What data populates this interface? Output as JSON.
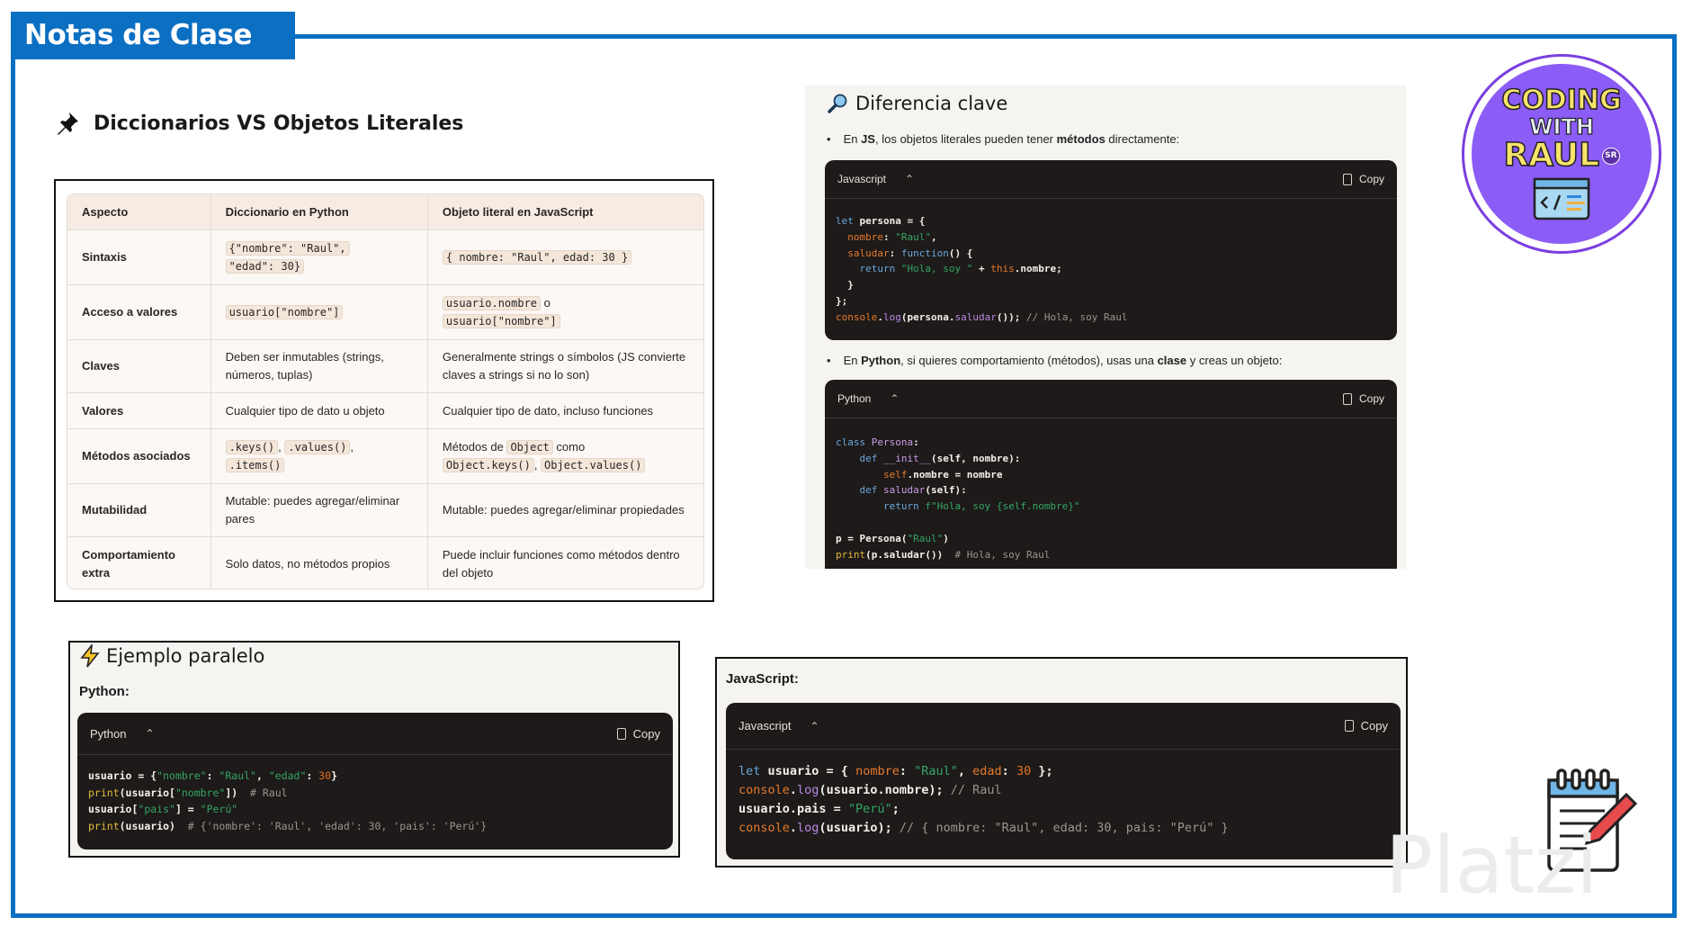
{
  "banner": {
    "title": "Notas de Clase"
  },
  "heading": {
    "title": "Diccionarios VS Objetos Literales",
    "icon": "pushpin-icon"
  },
  "table": {
    "headers": [
      "Aspecto",
      "Diccionario en Python",
      "Objeto literal en JavaScript"
    ],
    "rows": [
      [
        [
          {
            "t": "Sintaxis"
          }
        ],
        [
          {
            "t": "{\"nombre\": \"Raul\",",
            "code": true
          },
          {
            "br": true
          },
          {
            "t": "\"edad\": 30}",
            "code": true
          }
        ],
        [
          {
            "t": "{ nombre: \"Raul\", edad: 30 }",
            "code": true
          }
        ]
      ],
      [
        [
          {
            "t": "Acceso a valores"
          }
        ],
        [
          {
            "t": "usuario[\"nombre\"]",
            "code": true
          }
        ],
        [
          {
            "t": "usuario.nombre",
            "code": true
          },
          {
            "t": " o"
          },
          {
            "br": true
          },
          {
            "t": "usuario[\"nombre\"]",
            "code": true
          }
        ]
      ],
      [
        [
          {
            "t": "Claves"
          }
        ],
        [
          {
            "t": "Deben ser inmutables (strings, números, tuplas)"
          }
        ],
        [
          {
            "t": "Generalmente strings o símbolos (JS convierte claves a strings si no lo son)"
          }
        ]
      ],
      [
        [
          {
            "t": "Valores"
          }
        ],
        [
          {
            "t": "Cualquier tipo de dato u objeto"
          }
        ],
        [
          {
            "t": "Cualquier tipo de dato, incluso funciones"
          }
        ]
      ],
      [
        [
          {
            "t": "Métodos asociados"
          }
        ],
        [
          {
            "t": ".keys()",
            "code": true
          },
          {
            "t": ", "
          },
          {
            "t": ".values()",
            "code": true
          },
          {
            "t": ","
          },
          {
            "br": true
          },
          {
            "t": ".items()",
            "code": true
          }
        ],
        [
          {
            "t": "Métodos de "
          },
          {
            "t": "Object",
            "code": true
          },
          {
            "t": " como"
          },
          {
            "br": true
          },
          {
            "t": "Object.keys()",
            "code": true
          },
          {
            "t": ", "
          },
          {
            "t": "Object.values()",
            "code": true
          }
        ]
      ],
      [
        [
          {
            "t": "Mutabilidad"
          }
        ],
        [
          {
            "t": "Mutable: puedes agregar/eliminar pares"
          }
        ],
        [
          {
            "t": "Mutable: puedes agregar/eliminar propiedades"
          }
        ]
      ],
      [
        [
          {
            "t": "Comportamiento extra"
          }
        ],
        [
          {
            "t": "Solo datos, no métodos propios"
          }
        ],
        [
          {
            "t": "Puede incluir funciones como métodos dentro del objeto"
          }
        ]
      ]
    ]
  },
  "diferencia": {
    "title": "Diferencia clave",
    "icon": "magnifier-icon",
    "bullet1": [
      {
        "t": "En "
      },
      {
        "t": "JS",
        "b": true
      },
      {
        "t": ", los objetos literales pueden tener "
      },
      {
        "t": "métodos",
        "b": true
      },
      {
        "t": " directamente:"
      }
    ],
    "bullet2": [
      {
        "t": "En "
      },
      {
        "t": "Python",
        "b": true
      },
      {
        "t": ", si quieres comportamiento (métodos), usas una "
      },
      {
        "t": "clase",
        "b": true
      },
      {
        "t": " y creas un objeto:"
      }
    ],
    "js_block": {
      "lang": "Javascript",
      "copy": "Copy",
      "lines": [
        [
          [
            "k",
            "let"
          ],
          [
            "d",
            " persona = {"
          ]
        ],
        [
          [
            "d",
            "  "
          ],
          [
            "p",
            "nombre"
          ],
          [
            "d",
            ": "
          ],
          [
            "s",
            "\"Raul\""
          ],
          [
            "d",
            ","
          ]
        ],
        [
          [
            "d",
            "  "
          ],
          [
            "p",
            "saludar"
          ],
          [
            "d",
            ": "
          ],
          [
            "k",
            "function"
          ],
          [
            "d",
            "() {"
          ]
        ],
        [
          [
            "d",
            "    "
          ],
          [
            "k",
            "return"
          ],
          [
            "d",
            " "
          ],
          [
            "s",
            "\"Hola, soy \""
          ],
          [
            "d",
            " + "
          ],
          [
            "p",
            "this"
          ],
          [
            "d",
            ".nombre;"
          ]
        ],
        [
          [
            "d",
            "  }"
          ]
        ],
        [
          [
            "d",
            "};"
          ]
        ],
        [
          [
            "p",
            "console"
          ],
          [
            "d",
            "."
          ],
          [
            "f",
            "log"
          ],
          [
            "d",
            "(persona."
          ],
          [
            "f",
            "saludar"
          ],
          [
            "d",
            "()); "
          ],
          [
            "c",
            "// Hola, soy Raul"
          ]
        ]
      ]
    },
    "py_block": {
      "lang": "Python",
      "copy": "Copy",
      "lines": [
        [
          [
            "k",
            "class"
          ],
          [
            "d",
            " "
          ],
          [
            "pu",
            "Persona"
          ],
          [
            "d",
            ":"
          ]
        ],
        [
          [
            "d",
            "    "
          ],
          [
            "k",
            "def"
          ],
          [
            "d",
            " "
          ],
          [
            "pu",
            "__init__"
          ],
          [
            "d",
            "(self, nombre):"
          ]
        ],
        [
          [
            "d",
            "        "
          ],
          [
            "p",
            "self"
          ],
          [
            "d",
            ".nombre = nombre"
          ]
        ],
        [
          [
            "d",
            "    "
          ],
          [
            "k",
            "def"
          ],
          [
            "d",
            " "
          ],
          [
            "pu",
            "saludar"
          ],
          [
            "d",
            "(self):"
          ]
        ],
        [
          [
            "d",
            "        "
          ],
          [
            "k",
            "return"
          ],
          [
            "d",
            " "
          ],
          [
            "s",
            "f\"Hola, soy {self.nombre}\""
          ]
        ],
        [
          [
            "d",
            ""
          ]
        ],
        [
          [
            "d",
            "p = Persona("
          ],
          [
            "s",
            "\"Raul\""
          ],
          [
            "d",
            ")"
          ]
        ],
        [
          [
            "y",
            "print"
          ],
          [
            "d",
            "(p.saludar())  "
          ],
          [
            "c",
            "# Hola, soy Raul"
          ]
        ]
      ]
    }
  },
  "ejemplo": {
    "title": "Ejemplo paralelo",
    "icon": "lightning-icon",
    "label": "Python:",
    "block": {
      "lang": "Python",
      "copy": "Copy",
      "lines": [
        [
          [
            "d",
            "usuario = {"
          ],
          [
            "s",
            "\"nombre\""
          ],
          [
            "d",
            ": "
          ],
          [
            "s",
            "\"Raul\""
          ],
          [
            "d",
            ", "
          ],
          [
            "s",
            "\"edad\""
          ],
          [
            "d",
            ": "
          ],
          [
            "n",
            "30"
          ],
          [
            "d",
            "}"
          ]
        ],
        [
          [
            "y",
            "print"
          ],
          [
            "d",
            "(usuario["
          ],
          [
            "s",
            "\"nombre\""
          ],
          [
            "d",
            "])  "
          ],
          [
            "c",
            "# Raul"
          ]
        ],
        [
          [
            "d",
            "usuario["
          ],
          [
            "s",
            "\"pais\""
          ],
          [
            "d",
            "] = "
          ],
          [
            "s",
            "\"Perú\""
          ]
        ],
        [
          [
            "y",
            "print"
          ],
          [
            "d",
            "(usuario)  "
          ],
          [
            "c",
            "# {'nombre': 'Raul', 'edad': 30, 'pais': 'Perú'}"
          ]
        ]
      ]
    }
  },
  "javascript": {
    "label": "JavaScript:",
    "block": {
      "lang": "Javascript",
      "copy": "Copy",
      "lines": [
        [
          [
            "k",
            "let"
          ],
          [
            "d",
            " usuario = { "
          ],
          [
            "p",
            "nombre"
          ],
          [
            "d",
            ": "
          ],
          [
            "s",
            "\"Raul\""
          ],
          [
            "d",
            ", "
          ],
          [
            "p",
            "edad"
          ],
          [
            "d",
            ": "
          ],
          [
            "n",
            "30"
          ],
          [
            "d",
            " };"
          ]
        ],
        [
          [
            "p",
            "console"
          ],
          [
            "d",
            "."
          ],
          [
            "f",
            "log"
          ],
          [
            "d",
            "(usuario.nombre); "
          ],
          [
            "c",
            "// Raul"
          ]
        ],
        [
          [
            "d",
            "usuario.pais = "
          ],
          [
            "s",
            "\"Perú\""
          ],
          [
            "d",
            ";"
          ]
        ],
        [
          [
            "p",
            "console"
          ],
          [
            "d",
            "."
          ],
          [
            "f",
            "log"
          ],
          [
            "d",
            "(usuario); "
          ],
          [
            "c",
            "// { nombre: \"Raul\", edad: 30, pais: \"Perú\" }"
          ]
        ]
      ]
    }
  },
  "logo": {
    "line1": "CODING",
    "line2": "WITH",
    "line3": "RAUL",
    "badge": "SR",
    "colors": {
      "bg": "#8b5cf6",
      "text": "#f7e36a"
    }
  },
  "watermark": "Platzi",
  "colors": {
    "brand": "#0b6fc2",
    "code_bg": "#1d1a19"
  }
}
